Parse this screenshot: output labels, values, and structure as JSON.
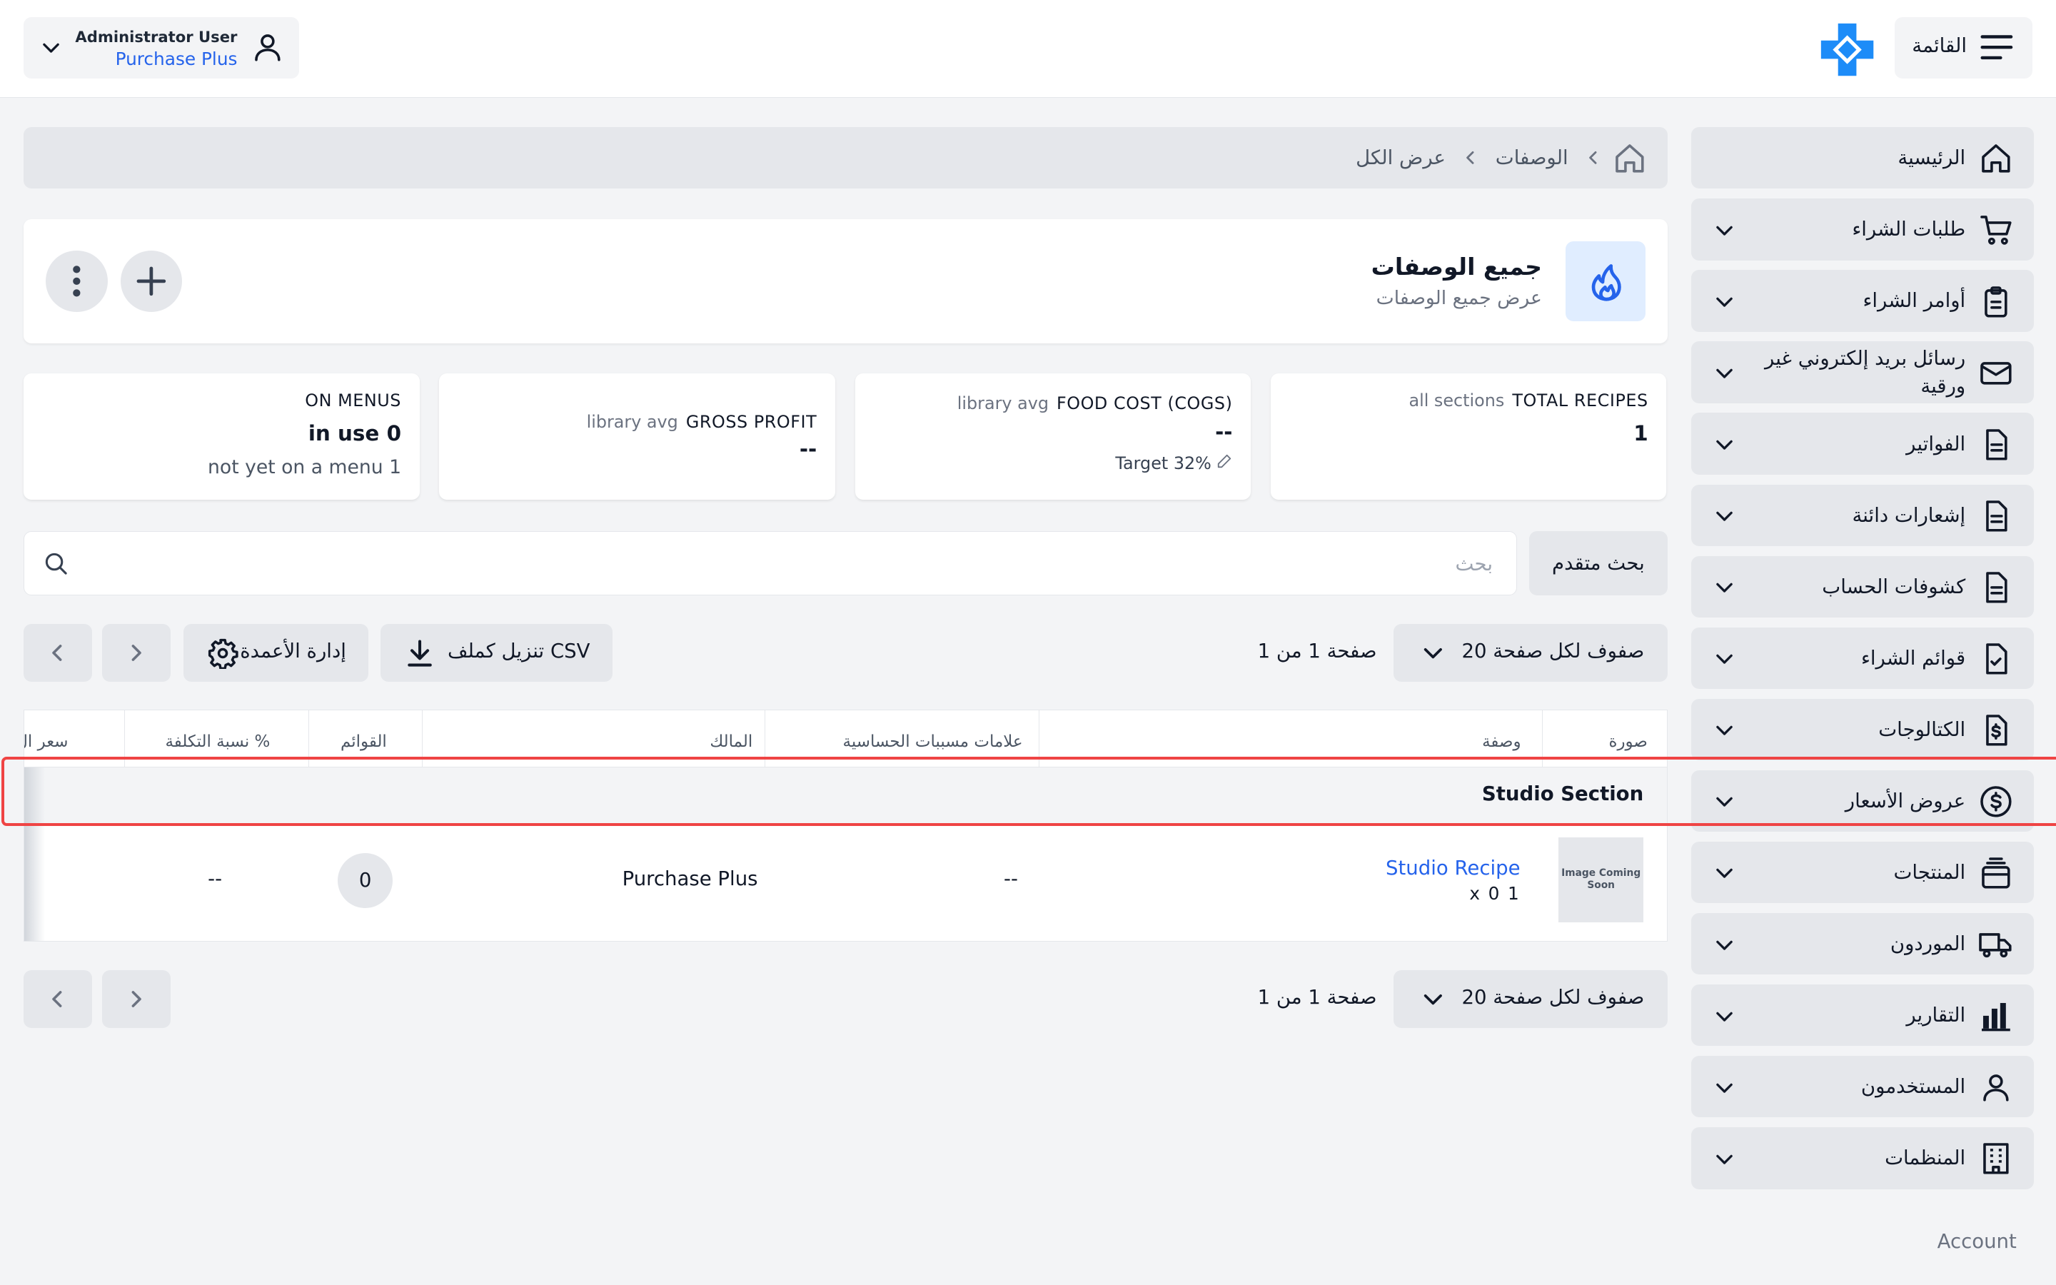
{
  "header": {
    "menu_label": "القائمة",
    "user_name": "Administrator User",
    "user_org": "Purchase Plus"
  },
  "sidebar": {
    "items": [
      {
        "label": "الرئيسية",
        "icon": "home-icon",
        "expandable": false
      },
      {
        "label": "طلبات الشراء",
        "icon": "cart-icon",
        "expandable": true
      },
      {
        "label": "أوامر الشراء",
        "icon": "clipboard-icon",
        "expandable": true
      },
      {
        "label": "رسائل بريد إلكتروني غير ورقية",
        "icon": "mail-icon",
        "expandable": true
      },
      {
        "label": "الفواتير",
        "icon": "document-icon",
        "expandable": true
      },
      {
        "label": "إشعارات دائنة",
        "icon": "document-icon",
        "expandable": true
      },
      {
        "label": "كشوفات الحساب",
        "icon": "document-icon",
        "expandable": true
      },
      {
        "label": "قوائم الشراء",
        "icon": "checklist-icon",
        "expandable": true
      },
      {
        "label": "الكتالوجات",
        "icon": "price-document-icon",
        "expandable": true
      },
      {
        "label": "عروض الأسعار",
        "icon": "dollar-circle-icon",
        "expandable": true
      },
      {
        "label": "المنتجات",
        "icon": "product-stack-icon",
        "expandable": true
      },
      {
        "label": "الموردون",
        "icon": "truck-icon",
        "expandable": true
      },
      {
        "label": "التقارير",
        "icon": "bar-chart-icon",
        "expandable": true
      },
      {
        "label": "المستخدمون",
        "icon": "user-icon",
        "expandable": true
      },
      {
        "label": "المنظمات",
        "icon": "building-icon",
        "expandable": true
      }
    ],
    "section_label": "Account"
  },
  "breadcrumb": {
    "items": [
      "الوصفات",
      "عرض الكل"
    ]
  },
  "page": {
    "title": "جميع الوصفات",
    "subtitle": "عرض جميع الوصفات"
  },
  "stats": {
    "total_recipes": {
      "label": "TOTAL RECIPES",
      "qualifier": "all sections",
      "value": "1"
    },
    "food_cost": {
      "label": "FOOD COST (COGS)",
      "qualifier": "library avg",
      "value": "--",
      "note": "Target 32%"
    },
    "gross_profit": {
      "label": "GROSS PROFIT",
      "qualifier": "library avg",
      "value": "--"
    },
    "on_menus": {
      "label": "ON MENUS",
      "value": "in use 0",
      "note": "not yet on a menu 1"
    }
  },
  "search": {
    "placeholder": "بحث",
    "advanced_label": "بحث متقدم"
  },
  "pagination": {
    "page_size_label": "20 صفوف لكل صفحة",
    "page_info": "صفحة 1 من 1"
  },
  "toolbar": {
    "download_csv_label": "تنزيل كملف CSV",
    "manage_columns_label": "إدارة الأعمدة"
  },
  "table": {
    "columns": {
      "image": "صورة",
      "recipe": "وصفة",
      "account_tags": "علامات مسببات الحساسية",
      "owner": "المالك",
      "menus": "القوائم",
      "cost_percent": "نسبة التكلفة %",
      "price": "سعر ال"
    },
    "group_label": "Studio Section",
    "rows": [
      {
        "image_text": "Image Coming Soon",
        "recipe_name": "Studio Recipe",
        "recipe_qty": "x 0 1",
        "account_tags": "--",
        "owner": "Purchase Plus",
        "menus": "0",
        "cost_percent": "--"
      }
    ]
  },
  "colors": {
    "accent": "#2563eb",
    "highlight": "#ef4444",
    "logo": "#1d8cf8"
  }
}
